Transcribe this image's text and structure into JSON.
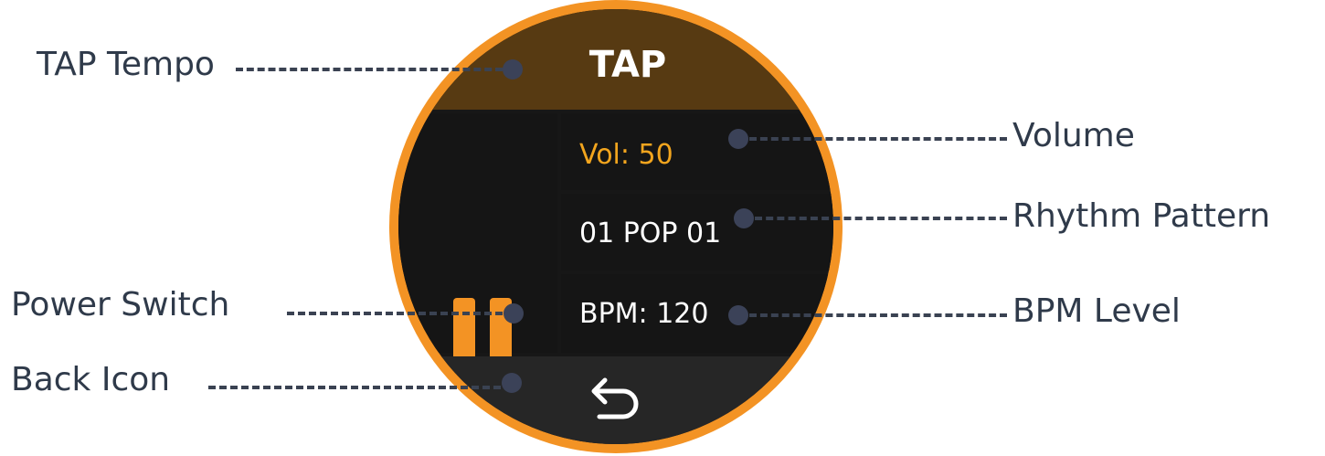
{
  "device": {
    "tap_label": "TAP",
    "volume_text": "Vol: 50",
    "pattern_text": "01 POP 01",
    "bpm_text": "BPM: 120"
  },
  "callouts": {
    "tap_tempo": "TAP Tempo",
    "power_switch": "Power Switch",
    "back_icon": "Back Icon",
    "volume": "Volume",
    "rhythm_pattern": "Rhythm Pattern",
    "bpm_level": "BPM Level"
  },
  "colors": {
    "accent_orange": "#f39324",
    "tap_bar_brown": "#573a12",
    "volume_text": "#f2a51e",
    "screen_dark": "#171717",
    "callout_text": "#2f3a4a"
  },
  "icons": {
    "power": "pause-icon",
    "back": "return-arrow-icon"
  }
}
